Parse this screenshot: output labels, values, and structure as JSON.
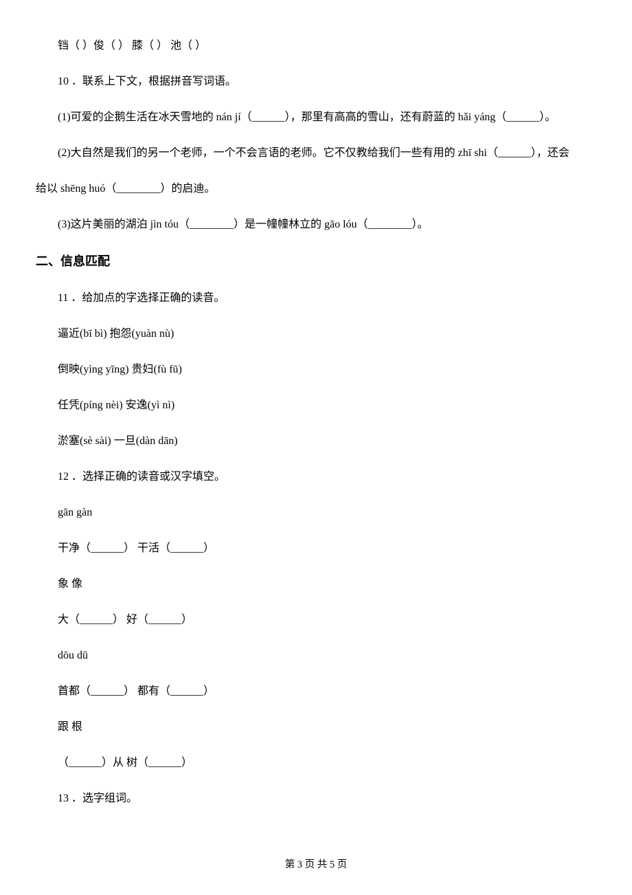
{
  "q9_line": "铛（     ）俊（     ）   膝（     ）   池（     ）",
  "q10_stem": "10 ．联系上下文，根据拼音写词语。",
  "q10_1": "(1)可爱的企鹅生活在冰天雪地的 nán jí（______），那里有高高的雪山，还有蔚蓝的 hǎi yáng（______）。",
  "q10_2a": "(2)大自然是我们的另一个老师，一个不会言语的老师。它不仅教给我们一些有用的 zhī shi（______），还会",
  "q10_2b": "给以 shēng huó（________）的启迪。",
  "q10_3": "(3)这片美丽的湖泊 jìn tóu（________）是一幢幢林立的 gāo lóu（________）。",
  "section2": "二、信息匹配",
  "q11_stem": "11 ．给加点的字选择正确的读音。",
  "q11_l1": "逼近(bī      bì)                         抱怨(yuàn      nù)",
  "q11_l2": "倒映(yìng    yīng)                  贵妇(fù    fū)",
  "q11_l3": "任凭(píng      nèi)                   安逸(yì      nì)",
  "q11_l4": "淤塞(sè      sài)                       一旦(dàn      dān)",
  "q12_stem": "12 ．选择正确的读音或汉字填空。",
  "q12_l1": "gān            gàn",
  "q12_l2": "干净（______）         干活（______）",
  "q12_l3": "象              像",
  "q12_l4": "大（______）         好（______）",
  "q12_l5": "dōu            dū",
  "q12_l6": "首都（______）         都有（______）",
  "q12_l7": "跟              根",
  "q12_l8": "（______）从            树（______）",
  "q13_stem": "13 ．选字组词。",
  "footer": "第 3 页 共 5 页"
}
